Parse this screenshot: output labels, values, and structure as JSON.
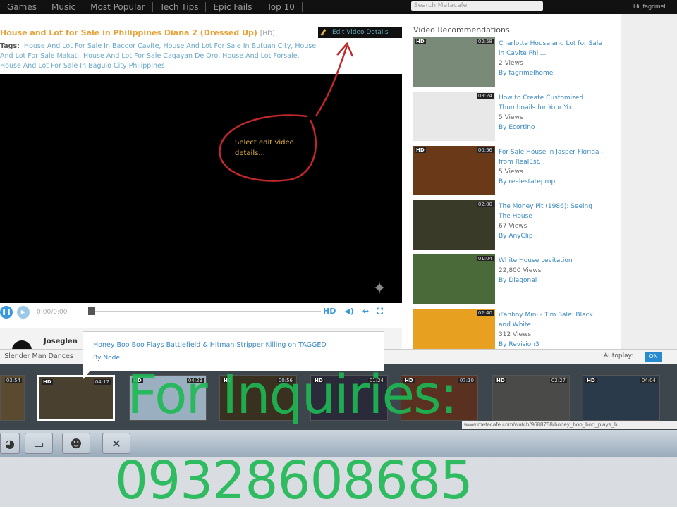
{
  "nav": {
    "items": [
      "Games",
      "Music",
      "Most Popular",
      "Tech Tips",
      "Epic Fails",
      "Top 10"
    ],
    "search_placeholder": "Search Metacafe",
    "user": "Hi, fagrimel"
  },
  "video": {
    "title": "House and Lot for Sale in Philippines Diana 2 (Dressed Up)",
    "quality": "[HD]",
    "edit_button": "Edit Video Details",
    "tags_label": "Tags:",
    "tags": "House And Lot For Sale In Bacoor Cavite, House And Lot For Sale In Butuan City, House And Lot For Sale Makati, House And Lot For Sale Cagayan De Oro, House And Lot Forsale, House And Lot For Sale In Baguio City Philippines",
    "annotation": "Select edit video details...",
    "time": "0:00/0:00",
    "hd": "HD"
  },
  "comments": {
    "user": "Joseglen"
  },
  "recommendations": {
    "heading": "Video Recommendations",
    "items": [
      {
        "title": "Charlotte House and Lot for Sale in Cavite Phil...",
        "views": "2 Views",
        "by": "By fagrimelhome",
        "duration": "02:58",
        "hd": "HD",
        "color": "#7a8a78"
      },
      {
        "title": "How to Create Customized Thumbnails for Your Yo...",
        "views": "5 Views",
        "by": "By Ecortino",
        "duration": "03:24",
        "hd": "",
        "color": "#e8e8e8"
      },
      {
        "title": "For Sale House in Jasper Florida - from RealEst...",
        "views": "5 Views",
        "by": "By realestateprop",
        "duration": "00:56",
        "hd": "HD",
        "color": "#6a3a18"
      },
      {
        "title": "The Money Pit (1986): Seeing The House",
        "views": "67 Views",
        "by": "By AnyClip",
        "duration": "02:00",
        "hd": "",
        "color": "#3a3a28"
      },
      {
        "title": "White House Levitation",
        "views": "22,800 Views",
        "by": "By Diagonal",
        "duration": "01:04",
        "hd": "",
        "color": "#4a6a3a"
      },
      {
        "title": "iFanboy Mini - Tim Sale: Black and White",
        "views": "312 Views",
        "by": "By Revision3",
        "duration": "02:40",
        "hd": "",
        "color": "#e8a020"
      }
    ]
  },
  "strip": {
    "now_playing": ": Slender Man Dances",
    "autoplay_label": "Autoplay:",
    "autoplay_value": "ON",
    "tooltip_title": "Honey Boo Boo Plays Battlefield & Hitman Stripper Killing on TAGGED",
    "tooltip_by": "By Node",
    "thumbs": [
      {
        "d": "03:54",
        "hd": ""
      },
      {
        "d": "04:17",
        "hd": "HD"
      },
      {
        "d": "04:23",
        "hd": "HD"
      },
      {
        "d": "00:56",
        "hd": "HD"
      },
      {
        "d": "01:24",
        "hd": "HD"
      },
      {
        "d": "07:10",
        "hd": "HD"
      },
      {
        "d": "02:27",
        "hd": "HD"
      },
      {
        "d": "04:04",
        "hd": "HD"
      }
    ],
    "url": "www.metacafe.com/watch/9688758/honey_boo_boo_plays_b"
  },
  "overlay": {
    "line1": "For Inquiries:",
    "line2": "09328608685"
  }
}
